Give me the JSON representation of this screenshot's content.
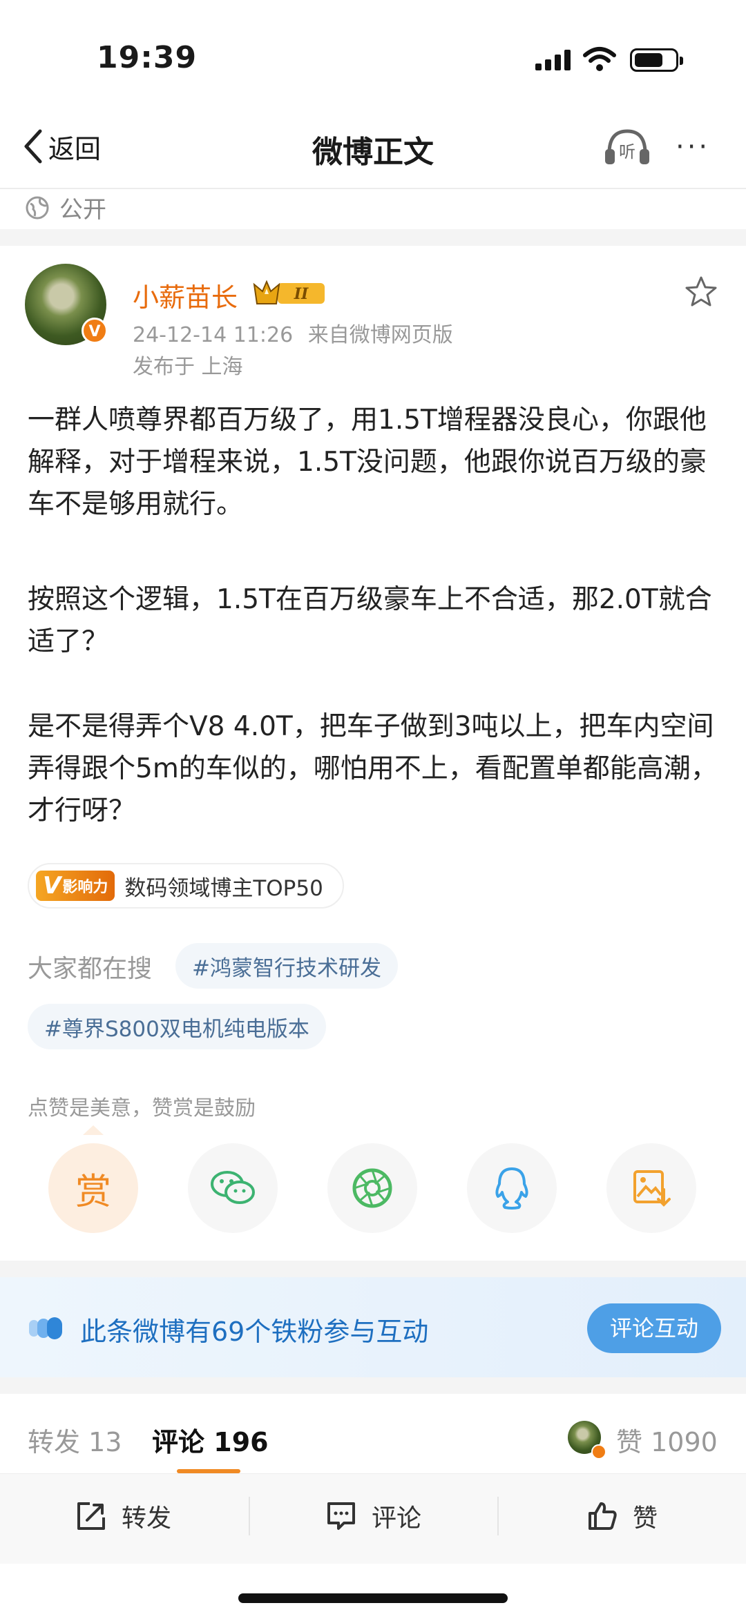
{
  "status_bar": {
    "time": "19:39"
  },
  "nav": {
    "back_label": "返回",
    "title": "微博正文",
    "listen_label": "听",
    "more_label": "···"
  },
  "visibility": {
    "label": "公开"
  },
  "author": {
    "name": "小薪苗长",
    "vip_level": "II",
    "verified_mark": "V",
    "timestamp": "24-12-14 11:26",
    "source": "来自微博网页版",
    "location": "发布于 上海"
  },
  "post": {
    "paragraphs": [
      "一群人喷尊界都百万级了，用1.5T增程器没良心，你跟他解释，对于增程来说，1.5T没问题，他跟你说百万级的豪车不是够用就行。",
      "按照这个逻辑，1.5T在百万级豪车上不合适，那2.0T就合适了？",
      "是不是得弄个V8 4.0T，把车子做到3吨以上，把车内空间弄得跟个5m的车似的，哪怕用不上，看配置单都能高潮，才行呀？"
    ]
  },
  "influence": {
    "logo_text": "影响力",
    "logo_letter": "V",
    "label": "数码领域博主TOP50"
  },
  "trending": {
    "label": "大家都在搜",
    "tags": [
      "#鸿蒙智行技术研发",
      "#尊界S800双电机纯电版本"
    ]
  },
  "reward": {
    "hint": "点赞是美意，赞赏是鼓励",
    "reward_label": "赏"
  },
  "share_targets": [
    "wechat-icon",
    "moments-icon",
    "qq-icon",
    "save-image-icon"
  ],
  "fans_banner": {
    "text": "此条微博有69个铁粉参与互动",
    "button": "评论互动"
  },
  "tabs": {
    "repost": {
      "label": "转发",
      "count": "13"
    },
    "comment": {
      "label": "评论",
      "count": "196"
    },
    "like": {
      "label": "赞",
      "count": "1090"
    }
  },
  "bottom_bar": {
    "repost": "转发",
    "comment": "评论",
    "like": "赞"
  },
  "colors": {
    "accent": "#f08a24",
    "author_name": "#e86b0c",
    "link": "#4a6e96",
    "fans_blue": "#1e6fc0"
  }
}
